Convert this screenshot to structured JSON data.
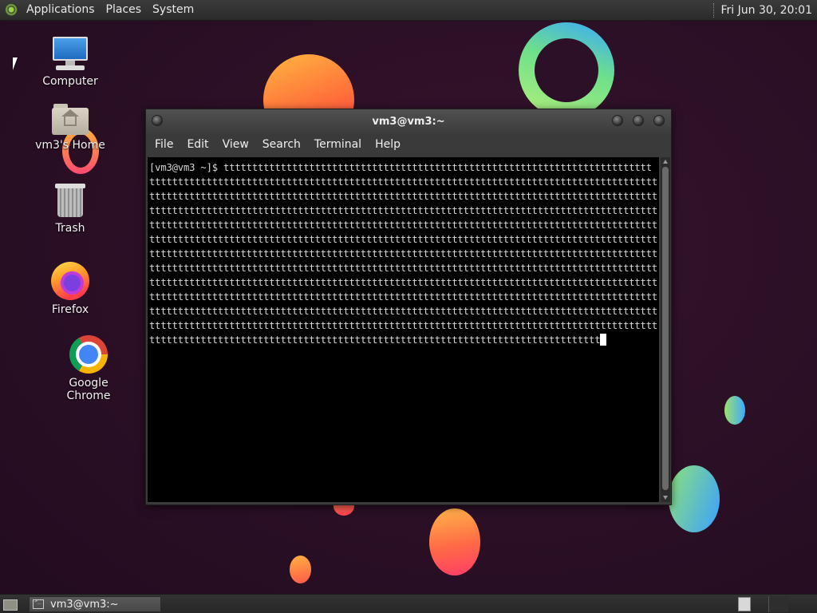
{
  "top_panel": {
    "menus": [
      "Applications",
      "Places",
      "System"
    ],
    "clock": "Fri Jun 30, 20:01"
  },
  "desktop_icons": [
    {
      "label": "Computer",
      "icon": "computer-icon"
    },
    {
      "label": "vm3's Home",
      "icon": "home-folder-icon"
    },
    {
      "label": "Trash",
      "icon": "trash-icon"
    },
    {
      "label": "Firefox",
      "icon": "firefox-icon"
    },
    {
      "label": "Google Chrome",
      "icon": "chrome-icon"
    }
  ],
  "terminal": {
    "title": "vm3@vm3:~",
    "menus": [
      "File",
      "Edit",
      "View",
      "Search",
      "Terminal",
      "Help"
    ],
    "prompt": "[vm3@vm3 ~]$ ",
    "typed_char": "t",
    "first_line_chars": 75,
    "full_line_chars": 89,
    "full_lines": 11,
    "last_line_chars": 79
  },
  "taskbar": {
    "window_label": "vm3@vm3:~"
  },
  "colors": {
    "panel": "#2b2b2b",
    "desktop_bg": "#2a0f24",
    "terminal_bg": "#000000",
    "terminal_fg": "#d8d8d8"
  }
}
